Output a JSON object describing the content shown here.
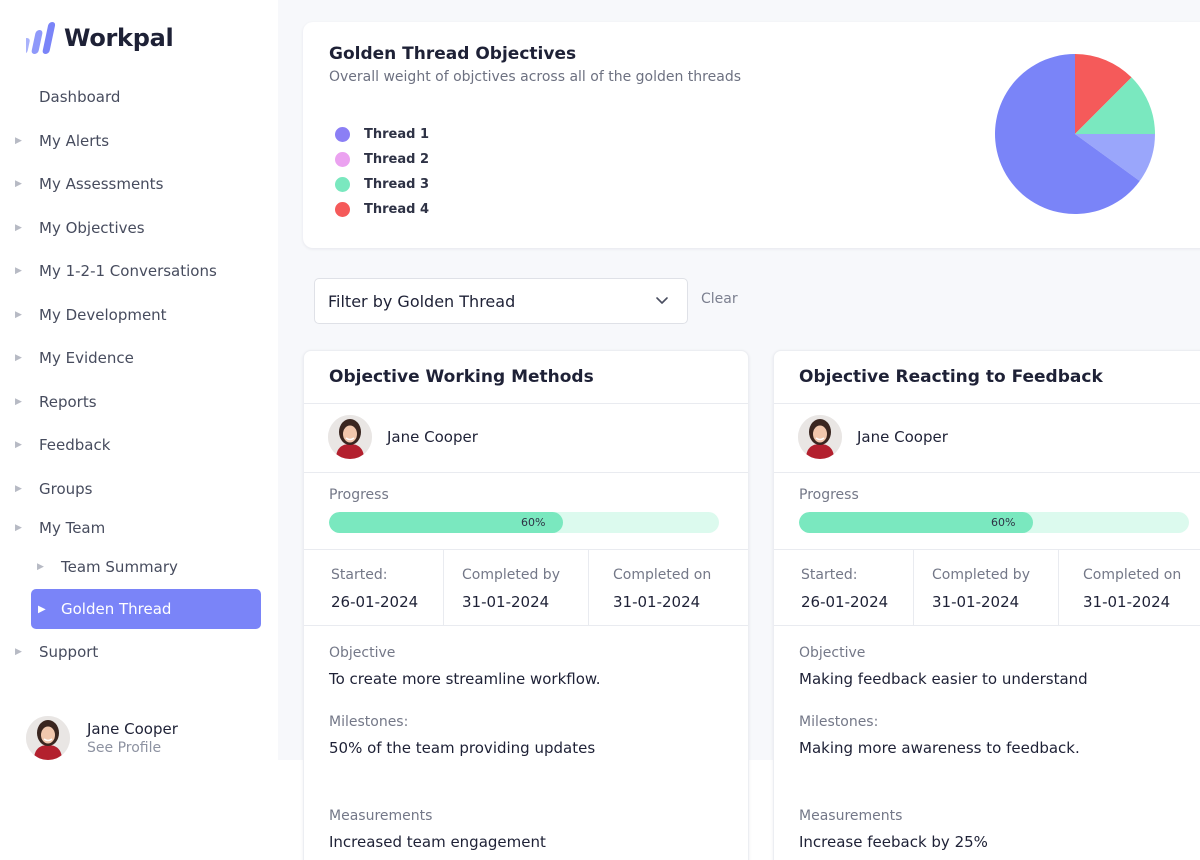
{
  "app": {
    "name": "Workpal"
  },
  "sidebar": {
    "items": [
      {
        "label": "Dashboard"
      },
      {
        "label": "My Alerts"
      },
      {
        "label": "My Assessments"
      },
      {
        "label": "My Objectives"
      },
      {
        "label": "My 1-2-1 Conversations"
      },
      {
        "label": "My Development"
      },
      {
        "label": "My Evidence"
      },
      {
        "label": "Reports"
      },
      {
        "label": "Feedback"
      },
      {
        "label": "Groups"
      },
      {
        "label": "My Team"
      },
      {
        "label": "Team Summary"
      },
      {
        "label": "Golden Thread"
      },
      {
        "label": "Support"
      }
    ],
    "profile": {
      "name": "Jane Cooper",
      "link": "See Profile"
    }
  },
  "overview": {
    "title": "Golden Thread Objectives",
    "subtitle": "Overall weight of objctives across all of the golden threads",
    "legend": [
      {
        "label": "Thread 1",
        "color": "#8b7ff5"
      },
      {
        "label": "Thread 2",
        "color": "#eba2f0"
      },
      {
        "label": "Thread 3",
        "color": "#7ae8bf"
      },
      {
        "label": "Thread 4",
        "color": "#f55a5a"
      }
    ]
  },
  "chart_data": {
    "type": "pie",
    "slices": [
      {
        "color": "#f55a5a",
        "value": 12.5
      },
      {
        "color": "#7ae8bf",
        "value": 12.5
      },
      {
        "color": "#9aa6fb",
        "value": 10
      },
      {
        "color": "#7a84f8",
        "value": 65
      }
    ]
  },
  "filter": {
    "label": "Filter by Golden Thread",
    "clear": "Clear"
  },
  "objectives": [
    {
      "title": "Objective Working Methods",
      "owner": "Jane Cooper",
      "progress_label": "Progress",
      "progress_value": 60,
      "progress_text": "60%",
      "started_label": "Started:",
      "started": "26-01-2024",
      "completed_by_label": "Completed by",
      "completed_by": "31-01-2024",
      "completed_on_label": "Completed on",
      "completed_on": "31-01-2024",
      "objective_label": "Objective",
      "objective": "To create more streamline workflow.",
      "milestones_label": "Milestones:",
      "milestones": "50% of the team providing  updates",
      "measurements_label": "Measurements",
      "measurements": "Increased team engagement"
    },
    {
      "title": "Objective Reacting to Feedback",
      "owner": "Jane Cooper",
      "progress_label": "Progress",
      "progress_value": 60,
      "progress_text": "60%",
      "started_label": "Started:",
      "started": "26-01-2024",
      "completed_by_label": "Completed by",
      "completed_by": "31-01-2024",
      "completed_on_label": "Completed on",
      "completed_on": "31-01-2024",
      "objective_label": "Objective",
      "objective": "Making feedback easier to understand",
      "milestones_label": "Milestones:",
      "milestones": "Making more awareness to feedback.",
      "measurements_label": "Measurements",
      "measurements": "Increase feeback by 25%"
    }
  ]
}
